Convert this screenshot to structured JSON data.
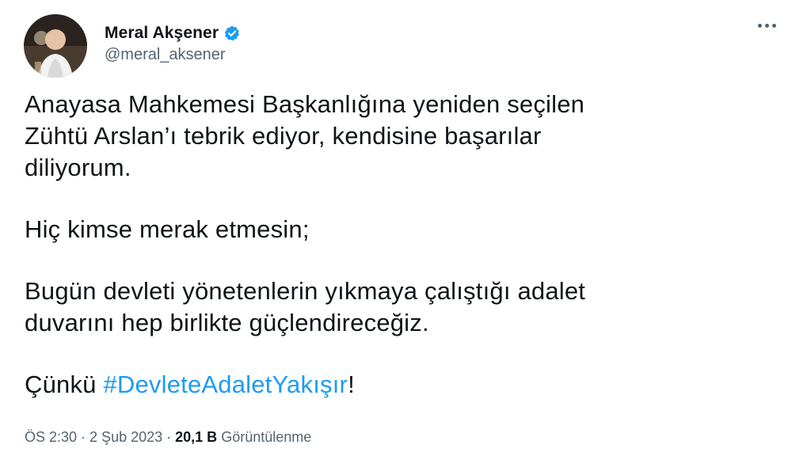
{
  "author": {
    "display_name": "Meral Akşener",
    "handle": "@meral_aksener",
    "verified": true
  },
  "tweet": {
    "line1": "Anayasa Mahkemesi Başkanlığına yeniden seçilen",
    "line2": "Zühtü Arslan’ı tebrik ediyor, kendisine başarılar",
    "line3": "diliyorum.",
    "line4": "Hiç kimse merak etmesin;",
    "line5": "Bugün devleti yönetenlerin yıkmaya çalıştığı adalet",
    "line6": "duvarını hep birlikte güçlendireceğiz.",
    "line7_prefix": "Çünkü ",
    "hashtag": "#DevleteAdaletYakışır",
    "line7_suffix": "!"
  },
  "meta": {
    "time": "ÖS 2:30",
    "separator1": " · ",
    "date": "2 Şub 2023",
    "separator2": " · ",
    "views_count": "20,1 B",
    "views_label": " Görüntülenme"
  },
  "colors": {
    "link": "#1d9bf0",
    "verified": "#1d9bf0",
    "secondary_text": "#536471"
  },
  "icons": {
    "verified": "verified-badge-icon",
    "more": "more-options-icon"
  }
}
